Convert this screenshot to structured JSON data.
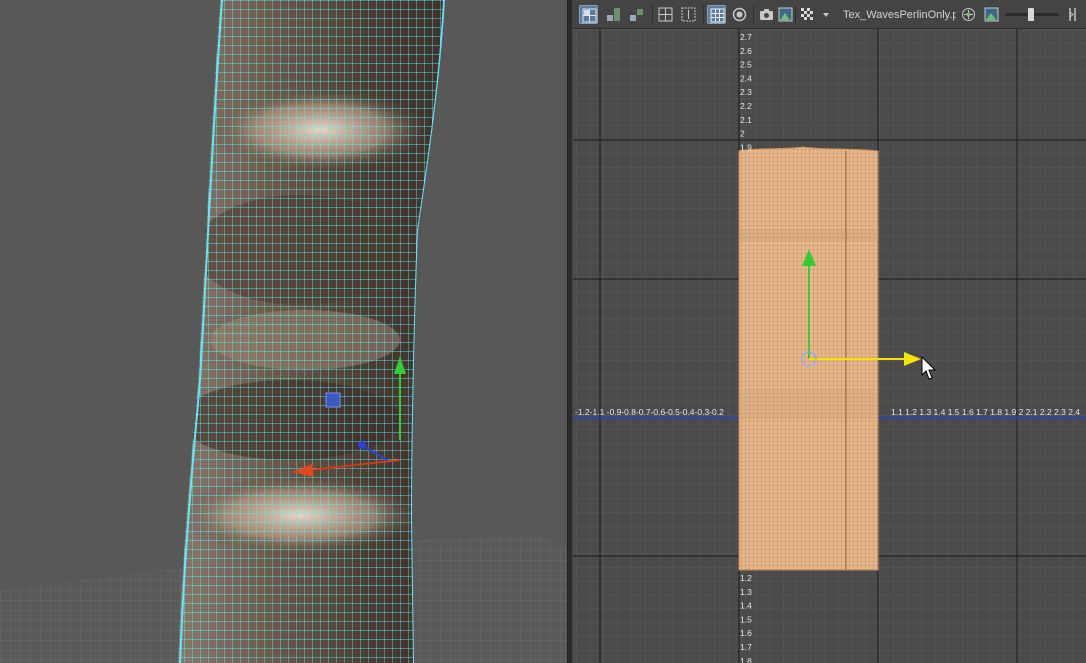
{
  "uv_editor": {
    "toolbar": {
      "texture_name": "Tex_WavesPerlinOnly.p",
      "buttons": [
        {
          "name": "uv-layout-icon",
          "active": true
        },
        {
          "name": "shell-layout-icon",
          "active": false
        },
        {
          "name": "stack-layout-icon",
          "active": false
        },
        {
          "name": "grid-snap-icon",
          "active": false
        },
        {
          "name": "pixel-snap-icon",
          "active": false
        },
        {
          "name": "toggle-grid-icon",
          "active": true
        },
        {
          "name": "shaded-uv-icon",
          "active": false
        },
        {
          "name": "snapshot-icon",
          "active": false
        },
        {
          "name": "image-display-icon",
          "active": false
        },
        {
          "name": "checker-icon",
          "active": false
        },
        {
          "name": "dropdown-arrow-icon",
          "active": false
        },
        {
          "name": "texture-tiling-icon",
          "active": false
        },
        {
          "name": "image-icon",
          "active": false
        },
        {
          "name": "exposure-slider",
          "active": false
        },
        {
          "name": "more-tools-icon",
          "active": false
        }
      ]
    },
    "v_axis_ticks_upper": [
      "2.7",
      "2.6",
      "2.5",
      "2.4",
      "2.3",
      "2.2",
      "2.1",
      "2",
      "1.9"
    ],
    "v_axis_ticks_lower": [
      "1.2",
      "1.3",
      "1.4",
      "1.5",
      "1.6",
      "1.7",
      "1.8"
    ],
    "u_axis_ticks_left": "-1.2-1.1 -0.9-0.8-0.7-0.6-0.5-0.4-0.3-0.2",
    "u_axis_ticks_right": "1.1 1.2 1.3 1.4 1.5 1.6 1.7 1.8 1.9 2 2.1 2.2 2.3 2.4",
    "colors": {
      "uv_shell": "#e8b88c",
      "uv_wire": "#b07a4a",
      "u_axis": "#1f3fd8",
      "move_y": "#33cc33",
      "move_x": "#f2e600",
      "mesh_wire": "#55e6ff"
    }
  }
}
